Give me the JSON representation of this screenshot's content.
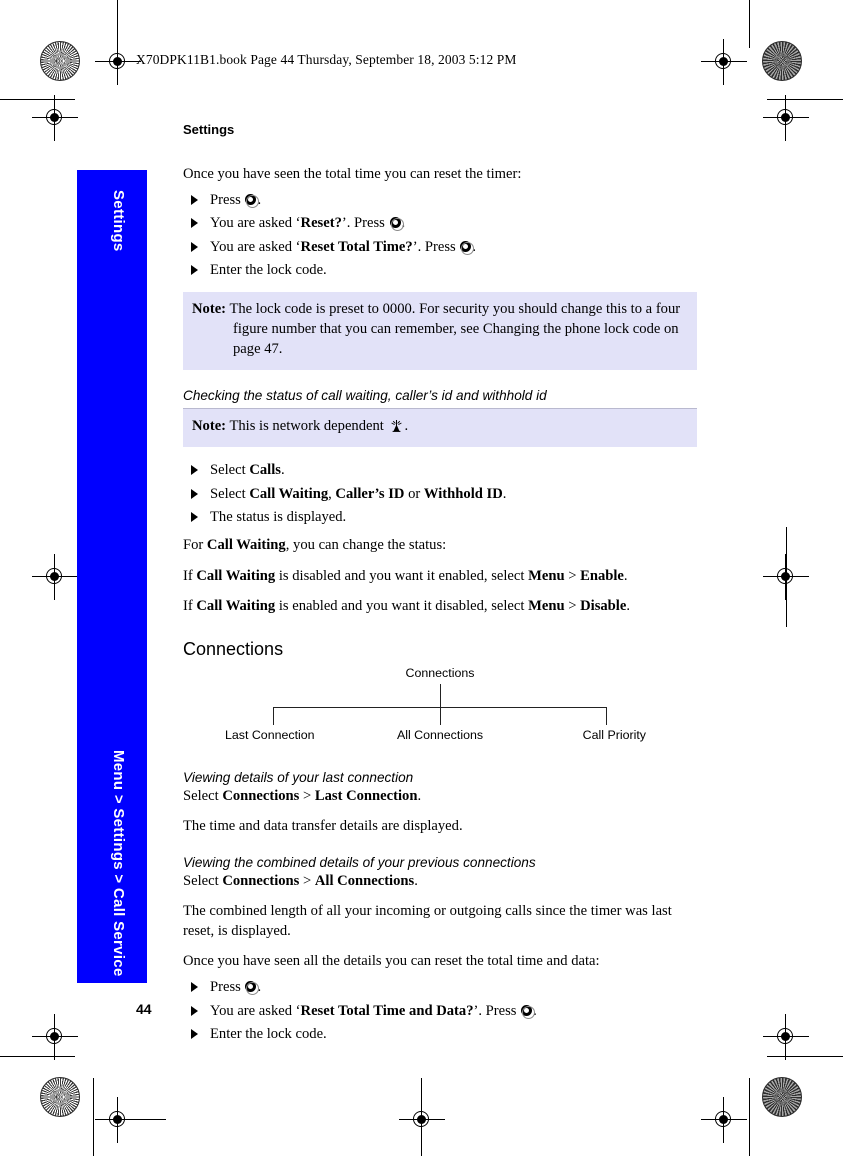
{
  "header": {
    "text": "X70DPK11B1.book  Page 44  Thursday, September 18, 2003  5:12 PM"
  },
  "side_tab": {
    "top_label": "Settings",
    "bottom_label": "Menu > Settings > Call Service",
    "color": "#0000ff"
  },
  "page": {
    "chapter_title": "Settings",
    "folio": "44"
  },
  "timer_section": {
    "intro": "Once you have seen the total time you can reset the timer:",
    "steps": [
      {
        "pre": "Press ",
        "key": "select-key",
        "post": "."
      },
      {
        "pre": "You are asked ‘",
        "bold": "Reset?",
        "mid": "’. Press ",
        "key": "select-key",
        "post": "."
      },
      {
        "pre": "You are asked ‘",
        "bold": "Reset Total Time?",
        "mid": "’. Press ",
        "key": "select-key",
        "post": "."
      },
      {
        "pre": "Enter the lock code."
      }
    ]
  },
  "note_lock_code": {
    "label": "Note:",
    "text": "The lock code is preset to 0000. For security you should change this to a four figure number that you can remember, see Changing the phone lock code on page 47.",
    "bg_color": "#e2e2f8"
  },
  "status_section": {
    "heading": "Checking the status of call waiting, caller’s id and withhold id",
    "note": {
      "label": "Note:",
      "text_before": "This is network dependent ",
      "icon": "antenna-icon",
      "text_after": "."
    },
    "steps": [
      {
        "pre": "Select ",
        "bold": "Calls",
        "post": "."
      },
      {
        "pre": "Select ",
        "bold": "Call Waiting",
        "mid": ", ",
        "bold2": "Caller’s ID",
        "mid2": " or ",
        "bold3": "Withhold ID",
        "post": "."
      },
      {
        "pre": "The status is displayed."
      }
    ],
    "para_for": {
      "pre": "For ",
      "bold": "Call Waiting",
      "post": ", you can change the status:"
    },
    "para_enable": {
      "pre": "If ",
      "bold": "Call Waiting",
      "mid": " is disabled and you want it enabled, select ",
      "bold2": "Menu",
      "mid2": " > ",
      "bold3": "Enable",
      "post": "."
    },
    "para_disable": {
      "pre": "If ",
      "bold": "Call Waiting",
      "mid": " is enabled and you want it disabled, select ",
      "bold2": "Menu",
      "mid2": " > ",
      "bold3": "Disable",
      "post": "."
    }
  },
  "connections_section": {
    "heading": "Connections",
    "diagram": {
      "root": "Connections",
      "leaves": [
        "Last Connection",
        "All Connections",
        "Call Priority"
      ]
    },
    "last_connection": {
      "heading": "Viewing details of your last connection",
      "select_pre": "Select ",
      "select_bold1": "Connections",
      "select_mid": " > ",
      "select_bold2": "Last Connection",
      "select_post": ".",
      "body": "The time and data transfer details are displayed."
    },
    "all_connections": {
      "heading": "Viewing the combined details of your previous connections",
      "select_pre": "Select ",
      "select_bold1": "Connections",
      "select_mid": " > ",
      "select_bold2": "All Connections",
      "select_post": ".",
      "body": "The combined length of all your incoming or outgoing calls since the timer was last reset, is displayed."
    },
    "reset": {
      "intro": "Once you have seen all the details you can reset the total time and data:",
      "steps": [
        {
          "pre": "Press ",
          "key": "select-key",
          "post": "."
        },
        {
          "pre": "You are asked ‘",
          "bold": "Reset Total Time and Data?",
          "mid": "’. Press ",
          "key": "select-key",
          "post": "."
        },
        {
          "pre": "Enter the lock code."
        }
      ]
    }
  }
}
